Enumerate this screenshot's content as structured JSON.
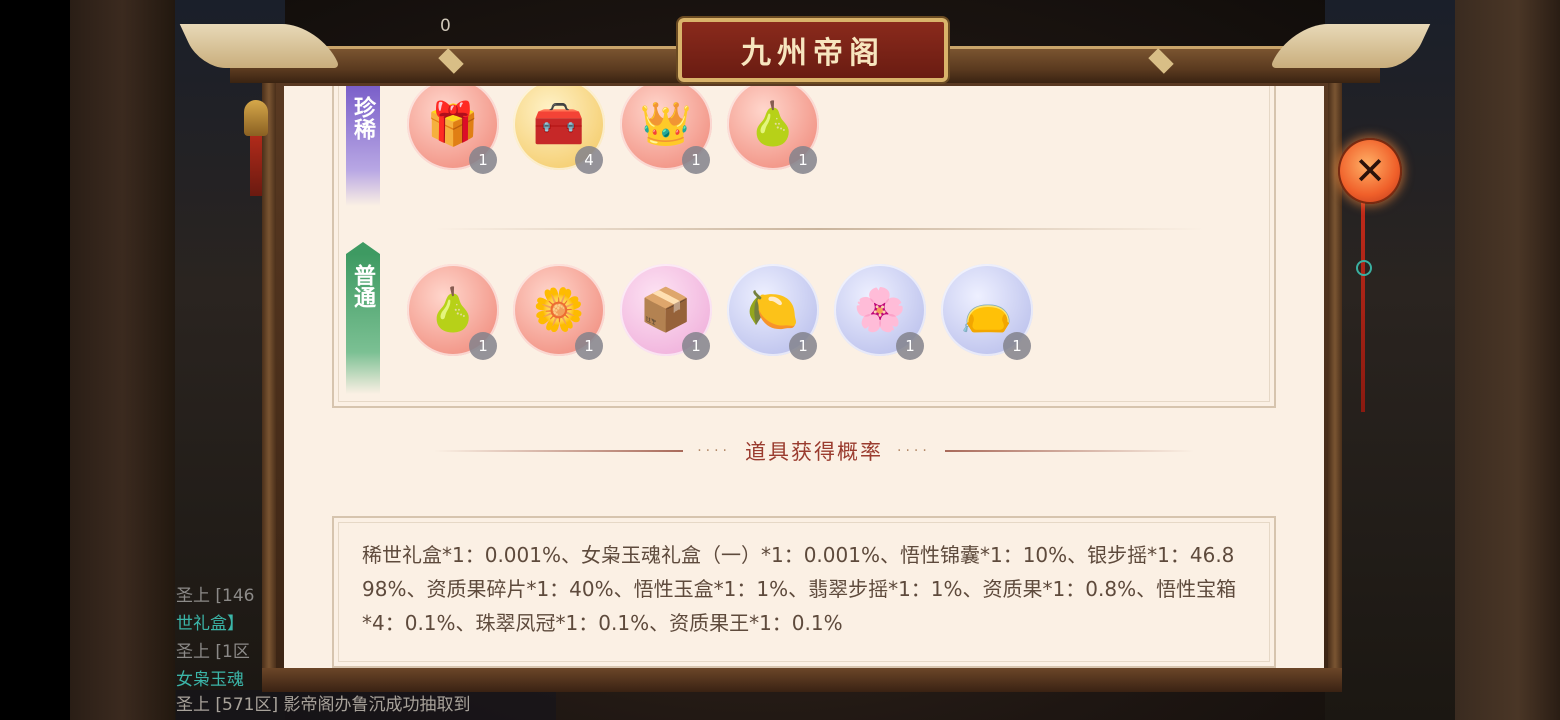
{
  "background": {
    "counter": "0",
    "chat_lines": [
      {
        "text": "圣上 [146",
        "style": "gray"
      },
      {
        "text": "世礼盒】",
        "style": "teal"
      },
      {
        "text": "圣上 [1区",
        "style": "gray"
      },
      {
        "text": "女枭玉魂",
        "style": "teal"
      }
    ],
    "chat_bottom": "圣上 [571区] 影帝阁办鲁沉成功抽取到"
  },
  "modal": {
    "title": "九州帝阁",
    "tiers": [
      {
        "label": "珍稀",
        "items": [
          {
            "icon": "gift-box-icon",
            "glyph": "🎁",
            "count": "1",
            "bg": "red"
          },
          {
            "icon": "treasure-chest-icon",
            "glyph": "🧰",
            "count": "4",
            "bg": "gold"
          },
          {
            "icon": "phoenix-crown-icon",
            "glyph": "👑",
            "count": "1",
            "bg": "red"
          },
          {
            "icon": "golden-fruit-king-icon",
            "glyph": "🍐",
            "count": "1",
            "bg": "red"
          }
        ]
      },
      {
        "label": "普通",
        "items": [
          {
            "icon": "golden-fruit-icon",
            "glyph": "🍐",
            "count": "1",
            "bg": "red"
          },
          {
            "icon": "jade-hairpin-icon",
            "glyph": "🌼",
            "count": "1",
            "bg": "red"
          },
          {
            "icon": "jade-box-icon",
            "glyph": "📦",
            "count": "1",
            "bg": "pink"
          },
          {
            "icon": "fruit-fragment-icon",
            "glyph": "🍋",
            "count": "1",
            "bg": "blue"
          },
          {
            "icon": "silver-hairpin-icon",
            "glyph": "🌸",
            "count": "1",
            "bg": "blue"
          },
          {
            "icon": "pouch-icon",
            "glyph": "👝",
            "count": "1",
            "bg": "blue"
          }
        ]
      }
    ],
    "probability_heading": "道具获得概率",
    "heading_dots": "····",
    "probability_text": "稀世礼盒*1：0.001%、女枭玉魂礼盒（一）*1：0.001%、悟性锦囊*1：10%、银步摇*1：46.898%、资质果碎片*1：40%、悟性玉盒*1：1%、翡翠步摇*1：1%、资质果*1：0.8%、悟性宝箱*4：0.1%、珠翠凤冠*1：0.1%、资质果王*1：0.1%",
    "close_glyph": "✕"
  }
}
